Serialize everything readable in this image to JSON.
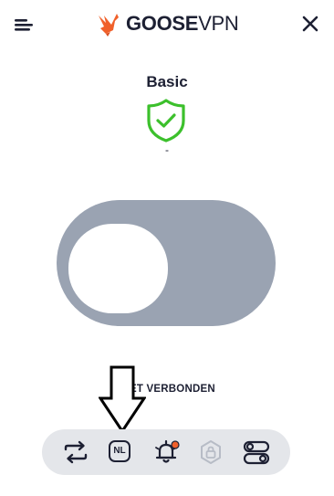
{
  "header": {
    "logo_bold": "GOOSE",
    "logo_light": "VPN",
    "menu_icon": "hamburger-menu-icon",
    "close_icon": "close-icon"
  },
  "plan": {
    "title": "Basic",
    "subtitle": "-",
    "status_icon": "shield-check-icon"
  },
  "connection": {
    "status": "NIET VERBONDEN",
    "connected": false
  },
  "bottom_nav": {
    "items": [
      {
        "icon": "switch-arrows-icon"
      },
      {
        "icon": "country-icon",
        "label": "NL"
      },
      {
        "icon": "notification-bell-icon",
        "has_badge": true
      },
      {
        "icon": "lock-badge-icon",
        "disabled": true
      },
      {
        "icon": "settings-toggles-icon"
      }
    ]
  },
  "colors": {
    "brand_orange": "#f0602a",
    "shield_green": "#3cc02c",
    "toggle_off": "#9aa3b2",
    "text_dark": "#1d2033",
    "bar_bg": "#e4e6ea"
  }
}
